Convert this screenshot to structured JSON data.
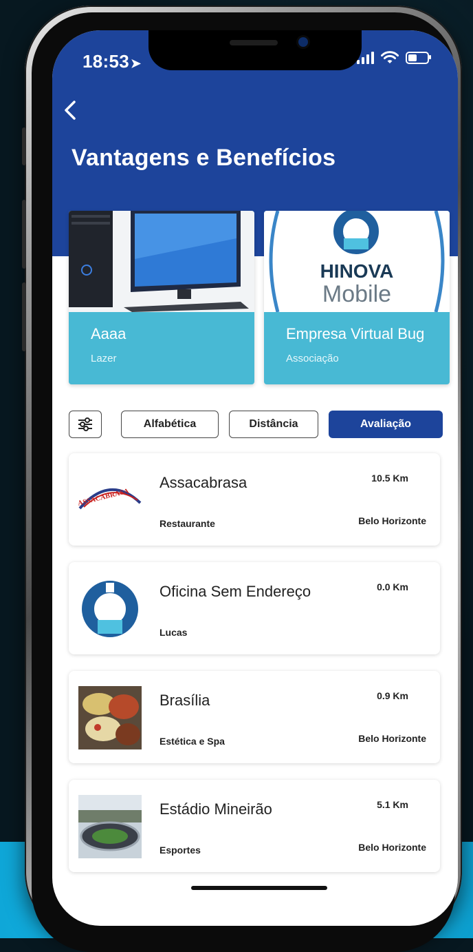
{
  "status_bar": {
    "time": "18:53"
  },
  "header": {
    "back_icon": "chevron-left-icon",
    "title": "Vantagens e Benefícios"
  },
  "featured": [
    {
      "name": "Aaaa",
      "category": "Lazer"
    },
    {
      "name": "Empresa Virtual Bug",
      "category": "Associação",
      "logo_text_1": "HINOVA",
      "logo_text_2": "Mobile"
    }
  ],
  "filters": {
    "settings_icon": "sliders-icon",
    "options": [
      {
        "label": "Alfabética",
        "active": false
      },
      {
        "label": "Distância",
        "active": false
      },
      {
        "label": "Avaliação",
        "active": true
      }
    ]
  },
  "partners": [
    {
      "name": "Assacabrasa",
      "category": "Restaurante",
      "distance": "10.5 Km",
      "city": "Belo Horizonte",
      "logo_text": "ASSACABRASA"
    },
    {
      "name": "Oficina Sem Endereço",
      "category": "Lucas",
      "distance": "0.0 Km",
      "city": ""
    },
    {
      "name": "Brasília",
      "category": "Estética e Spa",
      "distance": "0.9 Km",
      "city": "Belo Horizonte"
    },
    {
      "name": "Estádio Mineirão",
      "category": "Esportes",
      "distance": "5.1 Km",
      "city": "Belo Horizonte"
    }
  ],
  "colors": {
    "header": "#1d449b",
    "card_accent": "#48b9d4",
    "active_chip": "#1d449b",
    "background_accent": "#18b9e6"
  }
}
